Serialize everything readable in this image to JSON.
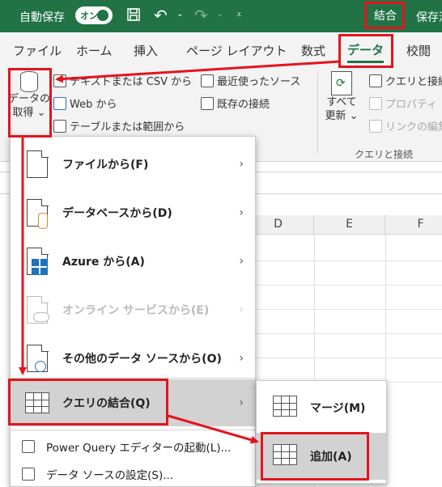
{
  "titlebar": {
    "autosave_label": "自動保存",
    "toggle_label": "オン",
    "combine_label": "結合",
    "save_label": "保存済",
    "save_icon": "save-icon",
    "undo_icon": "undo-icon",
    "redo_icon": "redo-icon",
    "customize_icon": "customize-qat-icon"
  },
  "tabs": [
    {
      "label": "ファイル"
    },
    {
      "label": "ホーム"
    },
    {
      "label": "挿入"
    },
    {
      "label": "ページ レイアウト"
    },
    {
      "label": "数式"
    },
    {
      "label": "データ",
      "active": true
    },
    {
      "label": "校閲"
    }
  ],
  "ribbon": {
    "get_data_label_1": "データの",
    "get_data_label_2": "取得",
    "get_data_chevron": "⌄",
    "text_csv": "テキストまたは CSV から",
    "web": "Web から",
    "table_range": "テーブルまたは範囲から",
    "recent_sources": "最近使ったソース",
    "existing_connections": "既存の接続",
    "refresh_all_1": "すべて",
    "refresh_all_2": "更新",
    "queries_connections": "クエリと接続",
    "properties": "プロパティ",
    "edit_links": "リンクの編集",
    "group_label": "クエリと接続"
  },
  "sheet": {
    "columns": [
      "D",
      "E",
      "F"
    ]
  },
  "menu": {
    "items": [
      {
        "label": "ファイルから(F)",
        "icon": "file-icon",
        "enabled": true
      },
      {
        "label": "データベースから(D)",
        "icon": "database-icon",
        "enabled": true
      },
      {
        "label": "Azure から(A)",
        "icon": "azure-icon",
        "enabled": true
      },
      {
        "label": "オンライン サービスから(E)",
        "icon": "online-service-icon",
        "enabled": false
      },
      {
        "label": "その他のデータ ソースから(O)",
        "icon": "other-source-icon",
        "enabled": true
      },
      {
        "label": "クエリの結合(Q)",
        "icon": "combine-queries-icon",
        "enabled": true,
        "highlighted": true
      }
    ],
    "power_query": "Power Query エディターの起動(L)...",
    "data_source_settings": "データ ソースの設定(S)..."
  },
  "submenu": {
    "items": [
      {
        "label": "マージ(M)",
        "icon": "merge-icon"
      },
      {
        "label": "追加(A)",
        "icon": "append-icon",
        "highlighted": true
      }
    ]
  },
  "annotation_color": "#e3141e",
  "accent_color": "#217346"
}
